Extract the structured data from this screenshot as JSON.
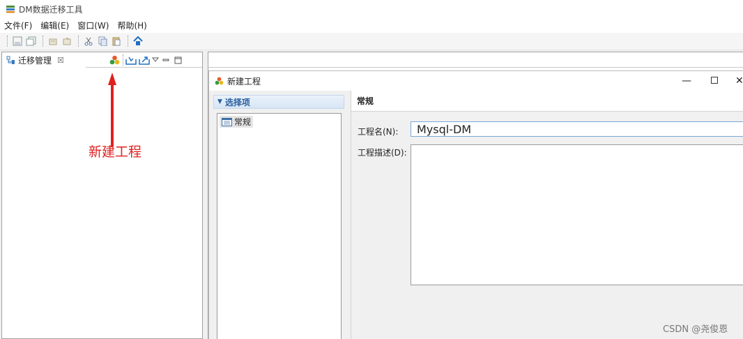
{
  "app": {
    "title": "DM数据迁移工具"
  },
  "menu": [
    "文件(F)",
    "编辑(E)",
    "窗口(W)",
    "帮助(H)"
  ],
  "left_view": {
    "tab_label": "迁移管理",
    "close_glyph": "☒"
  },
  "annotation": {
    "text": "新建工程",
    "color": "#e02020"
  },
  "dialog": {
    "title": "新建工程",
    "selection_header": "选择项",
    "option_item": "常规",
    "section_title": "常规",
    "name_label": "工程名(N):",
    "name_value": "Mysql-DM",
    "desc_label": "工程描述(D):",
    "desc_value": ""
  },
  "watermark": "CSDN @尧俊恩",
  "colors": {
    "accent": "#2a5f9e",
    "input_border": "#7aa7d6",
    "annotation": "#e02020"
  },
  "icons": [
    "app-icon",
    "save-icon",
    "save-all-icon",
    "undo-icon",
    "redo-icon",
    "cut-icon",
    "copy-icon",
    "paste-icon",
    "home-icon",
    "view-icon",
    "new-project-icon",
    "import-icon",
    "export-icon",
    "view-menu-icon",
    "minimize-icon",
    "maximize-icon",
    "option-icon"
  ]
}
